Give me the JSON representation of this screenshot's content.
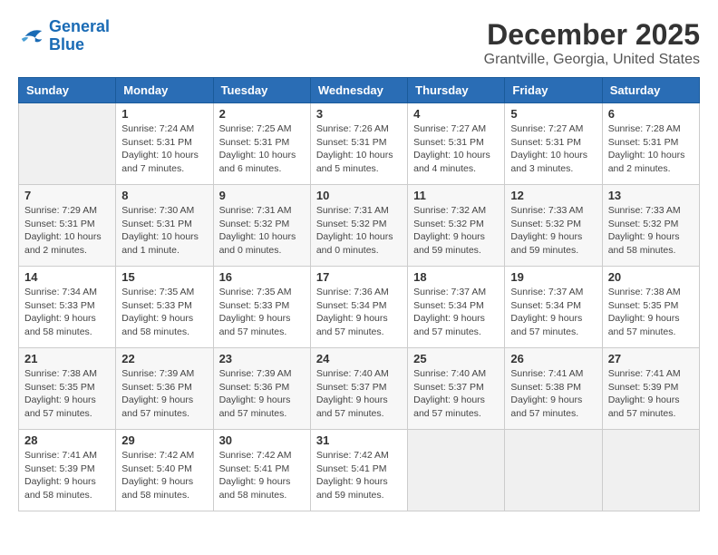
{
  "logo": {
    "line1": "General",
    "line2": "Blue"
  },
  "title": "December 2025",
  "location": "Grantville, Georgia, United States",
  "headers": [
    "Sunday",
    "Monday",
    "Tuesday",
    "Wednesday",
    "Thursday",
    "Friday",
    "Saturday"
  ],
  "weeks": [
    [
      {
        "day": "",
        "info": ""
      },
      {
        "day": "1",
        "info": "Sunrise: 7:24 AM\nSunset: 5:31 PM\nDaylight: 10 hours\nand 7 minutes."
      },
      {
        "day": "2",
        "info": "Sunrise: 7:25 AM\nSunset: 5:31 PM\nDaylight: 10 hours\nand 6 minutes."
      },
      {
        "day": "3",
        "info": "Sunrise: 7:26 AM\nSunset: 5:31 PM\nDaylight: 10 hours\nand 5 minutes."
      },
      {
        "day": "4",
        "info": "Sunrise: 7:27 AM\nSunset: 5:31 PM\nDaylight: 10 hours\nand 4 minutes."
      },
      {
        "day": "5",
        "info": "Sunrise: 7:27 AM\nSunset: 5:31 PM\nDaylight: 10 hours\nand 3 minutes."
      },
      {
        "day": "6",
        "info": "Sunrise: 7:28 AM\nSunset: 5:31 PM\nDaylight: 10 hours\nand 2 minutes."
      }
    ],
    [
      {
        "day": "7",
        "info": "Sunrise: 7:29 AM\nSunset: 5:31 PM\nDaylight: 10 hours\nand 2 minutes."
      },
      {
        "day": "8",
        "info": "Sunrise: 7:30 AM\nSunset: 5:31 PM\nDaylight: 10 hours\nand 1 minute."
      },
      {
        "day": "9",
        "info": "Sunrise: 7:31 AM\nSunset: 5:32 PM\nDaylight: 10 hours\nand 0 minutes."
      },
      {
        "day": "10",
        "info": "Sunrise: 7:31 AM\nSunset: 5:32 PM\nDaylight: 10 hours\nand 0 minutes."
      },
      {
        "day": "11",
        "info": "Sunrise: 7:32 AM\nSunset: 5:32 PM\nDaylight: 9 hours\nand 59 minutes."
      },
      {
        "day": "12",
        "info": "Sunrise: 7:33 AM\nSunset: 5:32 PM\nDaylight: 9 hours\nand 59 minutes."
      },
      {
        "day": "13",
        "info": "Sunrise: 7:33 AM\nSunset: 5:32 PM\nDaylight: 9 hours\nand 58 minutes."
      }
    ],
    [
      {
        "day": "14",
        "info": "Sunrise: 7:34 AM\nSunset: 5:33 PM\nDaylight: 9 hours\nand 58 minutes."
      },
      {
        "day": "15",
        "info": "Sunrise: 7:35 AM\nSunset: 5:33 PM\nDaylight: 9 hours\nand 58 minutes."
      },
      {
        "day": "16",
        "info": "Sunrise: 7:35 AM\nSunset: 5:33 PM\nDaylight: 9 hours\nand 57 minutes."
      },
      {
        "day": "17",
        "info": "Sunrise: 7:36 AM\nSunset: 5:34 PM\nDaylight: 9 hours\nand 57 minutes."
      },
      {
        "day": "18",
        "info": "Sunrise: 7:37 AM\nSunset: 5:34 PM\nDaylight: 9 hours\nand 57 minutes."
      },
      {
        "day": "19",
        "info": "Sunrise: 7:37 AM\nSunset: 5:34 PM\nDaylight: 9 hours\nand 57 minutes."
      },
      {
        "day": "20",
        "info": "Sunrise: 7:38 AM\nSunset: 5:35 PM\nDaylight: 9 hours\nand 57 minutes."
      }
    ],
    [
      {
        "day": "21",
        "info": "Sunrise: 7:38 AM\nSunset: 5:35 PM\nDaylight: 9 hours\nand 57 minutes."
      },
      {
        "day": "22",
        "info": "Sunrise: 7:39 AM\nSunset: 5:36 PM\nDaylight: 9 hours\nand 57 minutes."
      },
      {
        "day": "23",
        "info": "Sunrise: 7:39 AM\nSunset: 5:36 PM\nDaylight: 9 hours\nand 57 minutes."
      },
      {
        "day": "24",
        "info": "Sunrise: 7:40 AM\nSunset: 5:37 PM\nDaylight: 9 hours\nand 57 minutes."
      },
      {
        "day": "25",
        "info": "Sunrise: 7:40 AM\nSunset: 5:37 PM\nDaylight: 9 hours\nand 57 minutes."
      },
      {
        "day": "26",
        "info": "Sunrise: 7:41 AM\nSunset: 5:38 PM\nDaylight: 9 hours\nand 57 minutes."
      },
      {
        "day": "27",
        "info": "Sunrise: 7:41 AM\nSunset: 5:39 PM\nDaylight: 9 hours\nand 57 minutes."
      }
    ],
    [
      {
        "day": "28",
        "info": "Sunrise: 7:41 AM\nSunset: 5:39 PM\nDaylight: 9 hours\nand 58 minutes."
      },
      {
        "day": "29",
        "info": "Sunrise: 7:42 AM\nSunset: 5:40 PM\nDaylight: 9 hours\nand 58 minutes."
      },
      {
        "day": "30",
        "info": "Sunrise: 7:42 AM\nSunset: 5:41 PM\nDaylight: 9 hours\nand 58 minutes."
      },
      {
        "day": "31",
        "info": "Sunrise: 7:42 AM\nSunset: 5:41 PM\nDaylight: 9 hours\nand 59 minutes."
      },
      {
        "day": "",
        "info": ""
      },
      {
        "day": "",
        "info": ""
      },
      {
        "day": "",
        "info": ""
      }
    ]
  ]
}
